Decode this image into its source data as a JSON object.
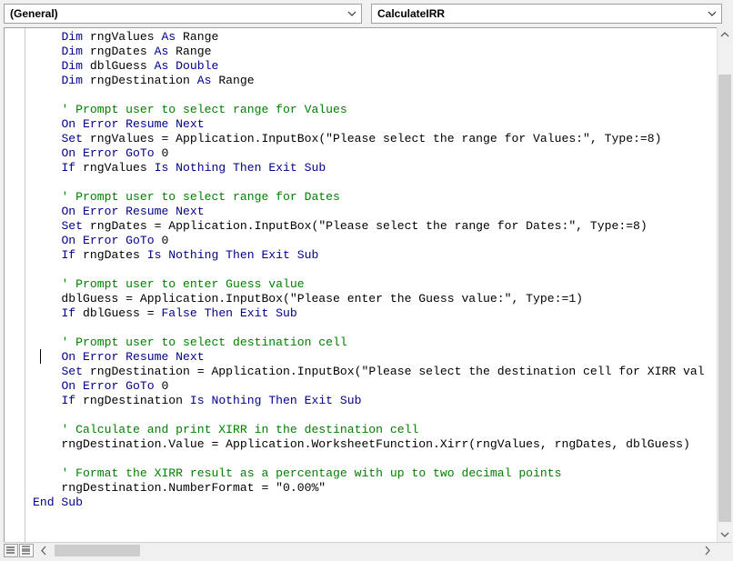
{
  "combos": {
    "object": "(General)",
    "procedure": "CalculateIRR"
  },
  "icons": {
    "dropdown": "chevron-down-icon",
    "procedure_view": "procedure-view-icon",
    "full_module_view": "full-module-view-icon"
  },
  "colors": {
    "keyword": "#00008b",
    "comment": "#008000",
    "text": "#000000"
  },
  "code_lines": [
    [
      {
        "t": "    "
      },
      {
        "k": "Dim"
      },
      {
        "t": " rngValues "
      },
      {
        "k": "As"
      },
      {
        "t": " Range"
      }
    ],
    [
      {
        "t": "    "
      },
      {
        "k": "Dim"
      },
      {
        "t": " rngDates "
      },
      {
        "k": "As"
      },
      {
        "t": " Range"
      }
    ],
    [
      {
        "t": "    "
      },
      {
        "k": "Dim"
      },
      {
        "t": " dblGuess "
      },
      {
        "k": "As"
      },
      {
        "t": " "
      },
      {
        "k": "Double"
      }
    ],
    [
      {
        "t": "    "
      },
      {
        "k": "Dim"
      },
      {
        "t": " rngDestination "
      },
      {
        "k": "As"
      },
      {
        "t": " Range"
      }
    ],
    [],
    [
      {
        "t": "    "
      },
      {
        "c": "' Prompt user to select range for Values"
      }
    ],
    [
      {
        "t": "    "
      },
      {
        "k": "On Error Resume Next"
      }
    ],
    [
      {
        "t": "    "
      },
      {
        "k": "Set"
      },
      {
        "t": " rngValues = Application.InputBox(\"Please select the range for Values:\", Type:=8)"
      }
    ],
    [
      {
        "t": "    "
      },
      {
        "k": "On Error GoTo"
      },
      {
        "t": " 0"
      }
    ],
    [
      {
        "t": "    "
      },
      {
        "k": "If"
      },
      {
        "t": " rngValues "
      },
      {
        "k": "Is Nothing Then Exit Sub"
      }
    ],
    [],
    [
      {
        "t": "    "
      },
      {
        "c": "' Prompt user to select range for Dates"
      }
    ],
    [
      {
        "t": "    "
      },
      {
        "k": "On Error Resume Next"
      }
    ],
    [
      {
        "t": "    "
      },
      {
        "k": "Set"
      },
      {
        "t": " rngDates = Application.InputBox(\"Please select the range for Dates:\", Type:=8)"
      }
    ],
    [
      {
        "t": "    "
      },
      {
        "k": "On Error GoTo"
      },
      {
        "t": " 0"
      }
    ],
    [
      {
        "t": "    "
      },
      {
        "k": "If"
      },
      {
        "t": " rngDates "
      },
      {
        "k": "Is Nothing Then Exit Sub"
      }
    ],
    [],
    [
      {
        "t": "    "
      },
      {
        "c": "' Prompt user to enter Guess value"
      }
    ],
    [
      {
        "t": "    dblGuess = Application.InputBox(\"Please enter the Guess value:\", Type:=1)"
      }
    ],
    [
      {
        "t": "    "
      },
      {
        "k": "If"
      },
      {
        "t": " dblGuess = "
      },
      {
        "k": "False Then Exit Sub"
      }
    ],
    [],
    [
      {
        "t": "    "
      },
      {
        "c": "' Prompt user to select destination cell"
      }
    ],
    [
      {
        "t": "    "
      },
      {
        "k": "On Error Resume Next"
      }
    ],
    [
      {
        "t": "    "
      },
      {
        "k": "Set"
      },
      {
        "t": " rngDestination = Application.InputBox(\"Please select the destination cell for XIRR val"
      }
    ],
    [
      {
        "t": "    "
      },
      {
        "k": "On Error GoTo"
      },
      {
        "t": " 0"
      }
    ],
    [
      {
        "t": "    "
      },
      {
        "k": "If"
      },
      {
        "t": " rngDestination "
      },
      {
        "k": "Is Nothing Then Exit Sub"
      }
    ],
    [],
    [
      {
        "t": "    "
      },
      {
        "c": "' Calculate and print XIRR in the destination cell"
      }
    ],
    [
      {
        "t": "    rngDestination.Value = Application.WorksheetFunction.Xirr(rngValues, rngDates, dblGuess)"
      }
    ],
    [],
    [
      {
        "t": "    "
      },
      {
        "c": "' Format the XIRR result as a percentage with up to two decimal points"
      }
    ],
    [
      {
        "t": "    rngDestination.NumberFormat = \"0.00%\""
      }
    ],
    [
      {
        "k": "End Sub"
      }
    ]
  ]
}
